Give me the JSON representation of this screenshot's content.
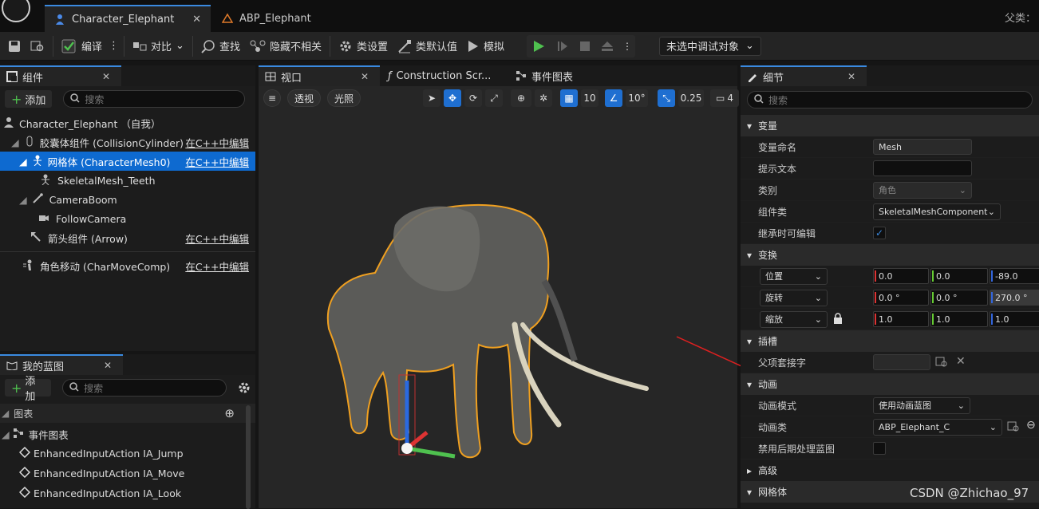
{
  "tabs": [
    {
      "label": "Character_Elephant",
      "close": "✕"
    },
    {
      "label": "ABP_Elephant"
    }
  ],
  "title_right": "父类：",
  "toolbar": {
    "compile": "编译",
    "diff": "对比",
    "find": "查找",
    "hide_unrelated": "隐藏不相关",
    "class_settings": "类设置",
    "class_defaults": "类默认值",
    "simulate": "模拟",
    "debug_object": "未选中调试对象"
  },
  "components": {
    "title": "组件",
    "add": "添加",
    "search_placeholder": "搜索",
    "items": [
      {
        "label": "Character_Elephant （自我）",
        "edit": ""
      },
      {
        "label": "胶囊体组件 (CollisionCylinder)",
        "edit": "在C++中编辑"
      },
      {
        "label": "网格体 (CharacterMesh0)",
        "edit": "在C++中编辑"
      },
      {
        "label": "SkeletalMesh_Teeth",
        "edit": ""
      },
      {
        "label": "CameraBoom",
        "edit": ""
      },
      {
        "label": "FollowCamera",
        "edit": ""
      },
      {
        "label": "箭头组件 (Arrow)",
        "edit": "在C++中编辑"
      },
      {
        "label": "角色移动 (CharMoveComp)",
        "edit": "在C++中编辑"
      }
    ]
  },
  "blueprint": {
    "title": "我的蓝图",
    "add": "添加",
    "search_placeholder": "搜索",
    "graphs_label": "图表",
    "event_graph": "事件图表",
    "events": [
      "EnhancedInputAction IA_Jump",
      "EnhancedInputAction IA_Move",
      "EnhancedInputAction IA_Look"
    ]
  },
  "center_tabs": {
    "viewport": "视口",
    "construction": "Construction Scr...",
    "event_graph": "事件图表"
  },
  "viewport": {
    "perspective": "透视",
    "lighting": "光照",
    "grid": "10",
    "angle": "10°",
    "scale": "0.25",
    "camera_speed": "4"
  },
  "details": {
    "title": "细节",
    "search_placeholder": "搜索",
    "sections": {
      "variable": "变量",
      "transform": "变换",
      "sockets": "插槽",
      "animation": "动画",
      "advanced": "高级",
      "mesh": "网格体"
    },
    "variable_name_label": "变量命名",
    "variable_name": "Mesh",
    "tooltip_label": "提示文本",
    "category_label": "类别",
    "category_value": "角色",
    "component_class_label": "组件类",
    "component_class": "SkeletalMeshComponent",
    "editable_label": "继承时可编辑",
    "location_label": "位置",
    "rotation_label": "旋转",
    "scale_label": "缩放",
    "location": [
      "0.0",
      "0.0",
      "-89.0"
    ],
    "rotation": [
      "0.0 °",
      "0.0 °",
      "270.0 °"
    ],
    "scale": [
      "1.0",
      "1.0",
      "1.0"
    ],
    "parent_socket_label": "父项套接字",
    "anim_mode_label": "动画模式",
    "anim_mode": "使用动画蓝图",
    "anim_class_label": "动画类",
    "anim_class": "ABP_Elephant_C",
    "disable_post_label": "禁用后期处理蓝图"
  },
  "watermark": "CSDN @Zhichao_97",
  "colors": {
    "accent": "#0e6ad0",
    "play": "#4fc14f",
    "outline": "#f0a020",
    "arrow": "#e02020"
  }
}
